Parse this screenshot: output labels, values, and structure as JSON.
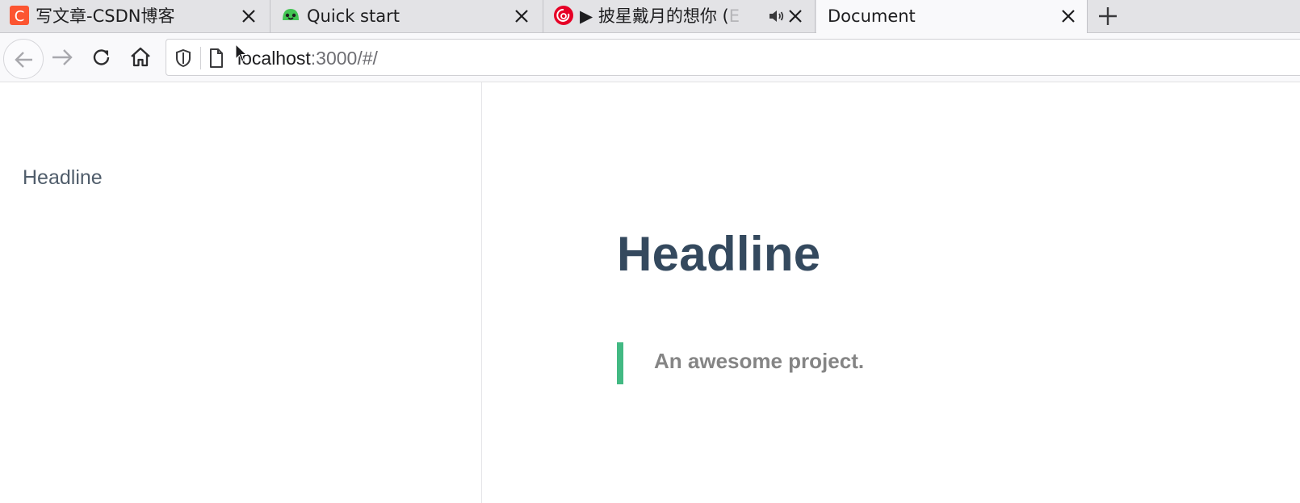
{
  "browser": {
    "tabs": [
      {
        "title": "写文章-CSDN博客",
        "favicon": "csdn-icon",
        "favicon_color": "#fc5531"
      },
      {
        "title": "Quick start",
        "favicon": "docsify-icon",
        "favicon_color": "#42c553"
      },
      {
        "title": "▶ 披星戴月的想你 (",
        "title_fade": "E",
        "favicon": "netease-music-icon",
        "favicon_color": "#e60026",
        "audio": "speaker-icon"
      },
      {
        "title": "Document",
        "active": true
      }
    ],
    "url": {
      "host": "localhost",
      "rest": ":3000/#/"
    }
  },
  "sidebar": {
    "items": [
      {
        "label": "Headline"
      }
    ]
  },
  "content": {
    "headline": "Headline",
    "blockquote": "An awesome project.",
    "accent_color": "#42b983"
  }
}
